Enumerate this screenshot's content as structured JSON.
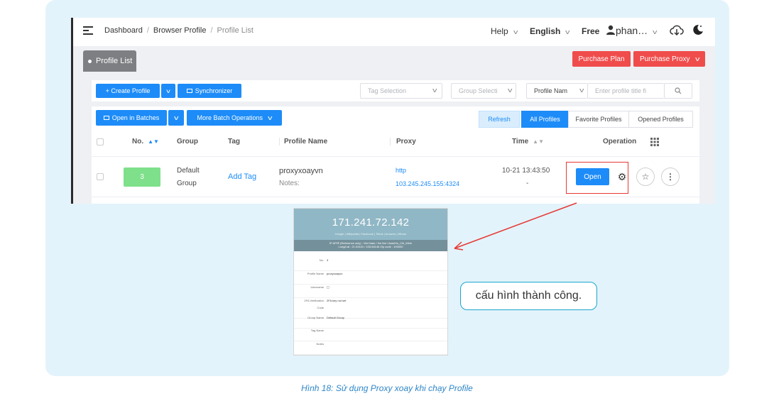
{
  "topbar": {
    "breadcrumbs": [
      "Dashboard",
      "Browser Profile",
      "Profile List"
    ],
    "help": "Help",
    "language": "English",
    "plan": "Free",
    "user": "phan…"
  },
  "tabs": {
    "active": "Profile List"
  },
  "actions": {
    "purchase_plan": "Purchase Plan",
    "purchase_proxy": "Purchase Proxy"
  },
  "toolbar": {
    "create_profile": "+ Create Profile",
    "synchronizer": "Synchronizer",
    "tag_selection_placeholder": "Tag Selection",
    "group_selection_placeholder": "Group Selecti",
    "profile_name_select": "Profile Nam",
    "search_placeholder": "Enter profile title fi"
  },
  "batch": {
    "open_in_batches": "Open in Batches",
    "more_batch_operations": "More Batch Operations",
    "refresh": "Refresh",
    "filters": [
      "All Profiles",
      "Favorite Profiles",
      "Opened Profiles"
    ]
  },
  "table": {
    "columns": [
      "No.",
      "Group",
      "Tag",
      "Profile Name",
      "Proxy",
      "Time",
      "Operation"
    ],
    "rows": [
      {
        "no": "3",
        "group_line1": "Default",
        "group_line2": "Group",
        "tag": "Add Tag",
        "profile_name": "proxyxoayvn",
        "notes": "Notes:",
        "proxy_type": "http",
        "proxy_addr": "103.245.245.155:4324",
        "time": "10-21 13:43:50",
        "time2": "-",
        "open": "Open"
      }
    ]
  },
  "result_page": {
    "ip": "171.241.72.142",
    "links": "Google  |  Wikipedia  |  Facebook  |  Tiktok  |  Amazon  |  Whoer",
    "geo_line1": "IP API® (Reference only)  :  Viet Nam  /  Ha Noi  /  Asia/Ho_Chi_Minh",
    "geo_line2": "Long/Lat :  21.02441  /  105.84146    Zip code :  100000",
    "fields": [
      {
        "k": "No.",
        "v": "3"
      },
      {
        "k": "Profile Name",
        "v": "proxyxoayvn"
      },
      {
        "k": "Username",
        "v": "▢"
      },
      {
        "k": "2FA Verification",
        "v": "2FA key not set"
      },
      {
        "k": "Code",
        "v": ""
      },
      {
        "k": "Group Name",
        "v": "Default Group"
      },
      {
        "k": "Tag Name",
        "v": ""
      },
      {
        "k": "Notes",
        "v": ""
      }
    ]
  },
  "bubble_text": "cấu hình thành công.",
  "caption": "Hình 18: Sử dụng Proxy xoay khi chạy Profile",
  "colors": {
    "blue": "#1d8cf8",
    "red": "#f04c4c",
    "green_badge": "#7ee08a",
    "annotation_red": "#e53935",
    "caption": "#2e86c8"
  }
}
